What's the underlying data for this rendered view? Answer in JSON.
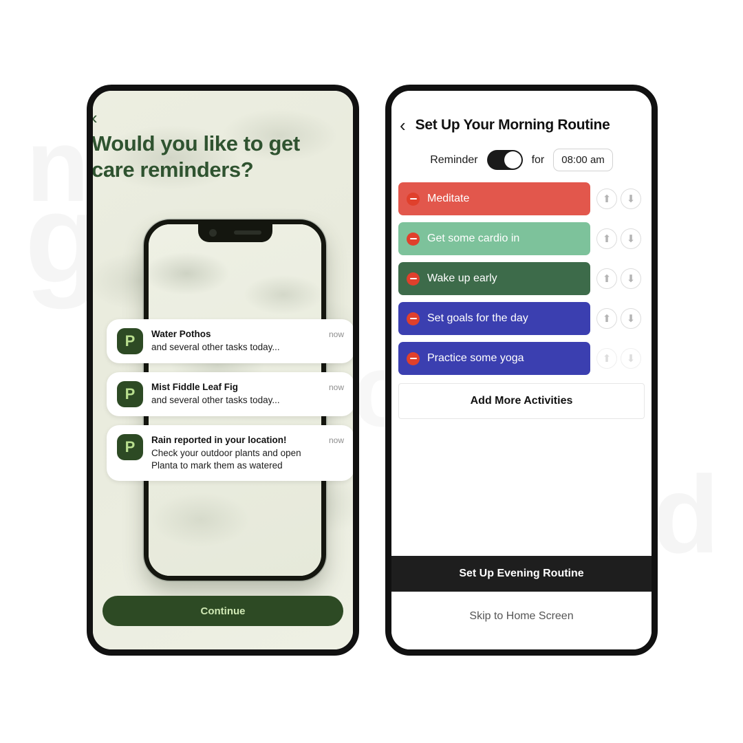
{
  "watermarks": [
    {
      "name": "watermark-n",
      "char": "n"
    },
    {
      "name": "watermark-g",
      "char": "g"
    },
    {
      "name": "watermark-c",
      "char": "c"
    },
    {
      "name": "watermark-d",
      "char": "d"
    }
  ],
  "left_phone": {
    "back_icon": "‹",
    "headline": "Would you like to get care reminders?",
    "headline_color": "#2f5330",
    "notifications": [
      {
        "app_initial": "P",
        "title": "Water Pothos",
        "text": "and several other tasks today...",
        "time": "now"
      },
      {
        "app_initial": "P",
        "title": "Mist Fiddle Leaf Fig",
        "text": "and several other tasks today...",
        "time": "now"
      },
      {
        "app_initial": "P",
        "title": "Rain reported in your location!",
        "text": "Check your outdoor plants and open Planta to mark them as watered",
        "time": "now"
      }
    ],
    "continue_label": "Continue",
    "continue_bg": "#2d4a24",
    "continue_color": "#cfe8b4"
  },
  "right_phone": {
    "back_icon": "‹",
    "title": "Set Up Your Morning Routine",
    "reminder": {
      "label": "Reminder",
      "toggle_on": true,
      "for_label": "for",
      "time_value": "08:00 am"
    },
    "activities": [
      {
        "label": "Meditate",
        "color": "#e2574c",
        "up": "⬆",
        "down": "⬇",
        "dim": false
      },
      {
        "label": "Get some cardio in",
        "color": "#7dc29b",
        "up": "⬆",
        "down": "⬇",
        "dim": false
      },
      {
        "label": "Wake up early",
        "color": "#3d6b4a",
        "up": "⬆",
        "down": "⬇",
        "dim": false
      },
      {
        "label": "Set goals for the day",
        "color": "#3b3fb0",
        "up": "⬆",
        "down": "⬇",
        "dim": false
      },
      {
        "label": "Practice some yoga",
        "color": "#3b3fb0",
        "up": "⬆",
        "down": "⬇",
        "dim": true
      }
    ],
    "add_more_label": "Add More Activities",
    "evening_label": "Set Up Evening Routine",
    "skip_label": "Skip to Home Screen"
  }
}
